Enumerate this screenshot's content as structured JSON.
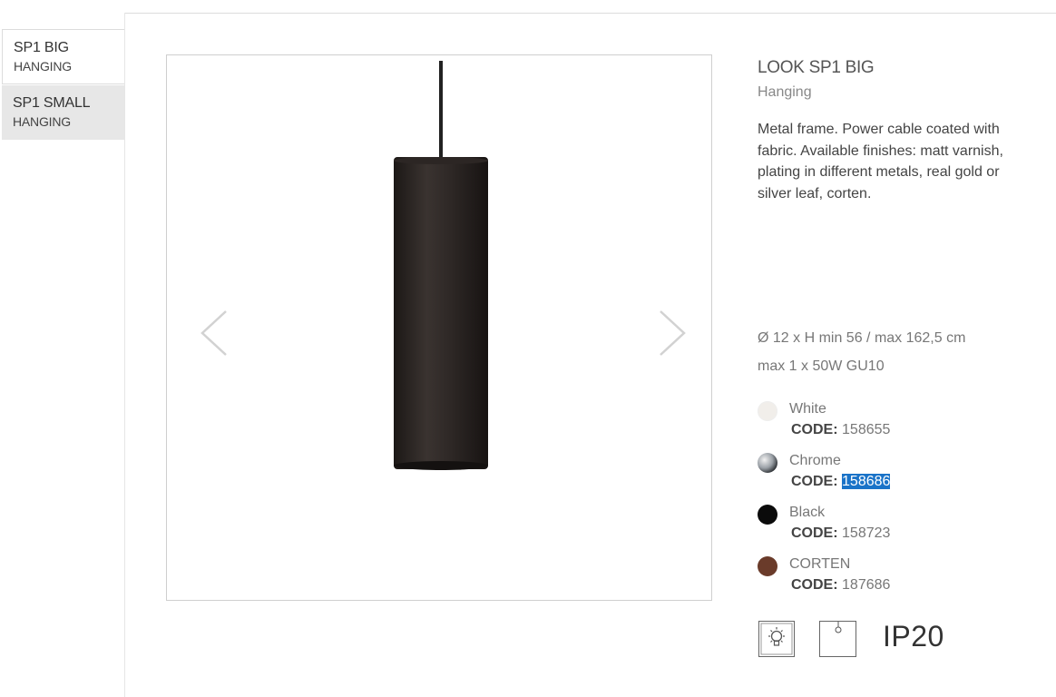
{
  "tabs": [
    {
      "line1": "SP1 BIG",
      "line2": "HANGING",
      "active": true
    },
    {
      "line1": "SP1 SMALL",
      "line2": "HANGING",
      "active": false
    }
  ],
  "product": {
    "title": "LOOK SP1 BIG",
    "subtitle": "Hanging",
    "description": "Metal frame. Power cable coated with fabric. Available finishes: matt varnish, plating in different metals, real gold or silver leaf, corten.",
    "dimensions": "Ø 12 x H min 56 / max 162,5 cm",
    "lamp": "max 1 x 50W GU10"
  },
  "finishes": [
    {
      "name": "White",
      "code_label": "CODE:",
      "code": "158655",
      "color": "#f1eeea"
    },
    {
      "name": "Chrome",
      "code_label": "CODE:",
      "code": "158686",
      "color": "#8a8f96",
      "selected": true
    },
    {
      "name": "Black",
      "code_label": "CODE:",
      "code": "158723",
      "color": "#0b0b0b"
    },
    {
      "name": "CORTEN",
      "code_label": "CODE:",
      "code": "187686",
      "color": "#6a3b2a"
    }
  ],
  "icons": [
    "bulb-icon",
    "ceiling-mount-icon"
  ],
  "ip_rating": "IP20",
  "colors": {
    "lamp_body": "#2a2422",
    "selection": "#1a73c8"
  }
}
